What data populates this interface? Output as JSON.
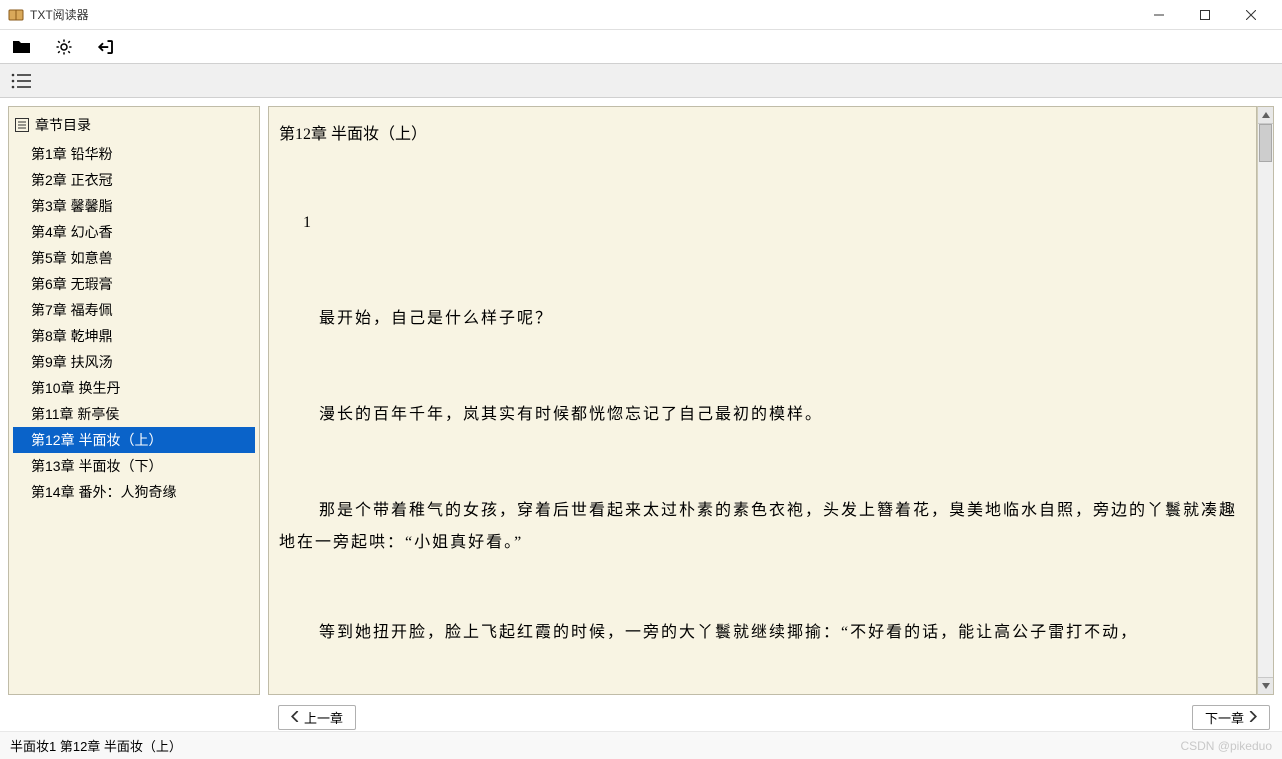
{
  "window": {
    "title": "TXT阅读器"
  },
  "sidebar": {
    "header": "章节目录",
    "items": [
      {
        "label": "第1章 铅华粉"
      },
      {
        "label": "第2章 正衣冠"
      },
      {
        "label": "第3章 馨馨脂"
      },
      {
        "label": "第4章 幻心香"
      },
      {
        "label": "第5章 如意兽"
      },
      {
        "label": "第6章 无瑕膏"
      },
      {
        "label": "第7章 福寿佩"
      },
      {
        "label": "第8章 乾坤鼎"
      },
      {
        "label": "第9章 扶风汤"
      },
      {
        "label": "第10章 换生丹"
      },
      {
        "label": "第11章 新亭侯"
      },
      {
        "label": "第12章 半面妆（上）"
      },
      {
        "label": "第13章 半面妆（下）"
      },
      {
        "label": "第14章 番外：人狗奇缘"
      }
    ],
    "selected_index": 11
  },
  "content": {
    "title": "第12章 半面妆（上）",
    "paragraphs": [
      "1",
      "最开始，自己是什么样子呢？",
      "漫长的百年千年，岚其实有时候都恍惚忘记了自己最初的模样。",
      "那是个带着稚气的女孩，穿着后世看起来太过朴素的素色衣袍，头发上簪着花，臭美地临水自照，旁边的丫鬟就凑趣地在一旁起哄：“小姐真好看。”",
      "等到她扭开脸，脸上飞起红霞的时候，一旁的大丫鬟就继续揶揄：“不好看的话，能让高公子雷打不动，"
    ]
  },
  "nav": {
    "prev": "上一章",
    "next": "下一章"
  },
  "status": {
    "text": "半面妆1   第12章 半面妆（上）"
  },
  "watermark": "CSDN @pikeduo"
}
